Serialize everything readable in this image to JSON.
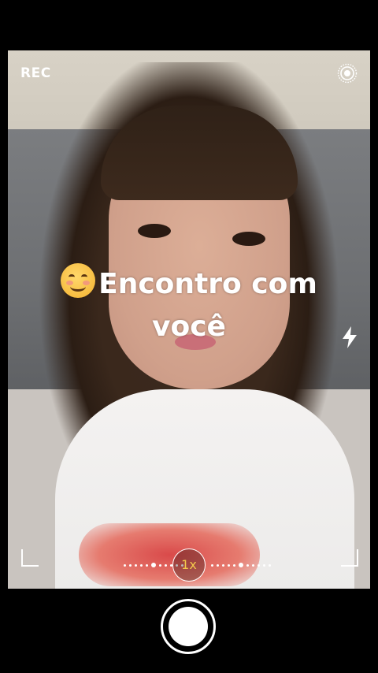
{
  "camera": {
    "mode_label": "REC",
    "caption_text": "Encontro com você",
    "zoom_label": "1x",
    "icons": {
      "top_right": "live-photo-icon",
      "flash": "flash-icon",
      "shutter": "shutter-button"
    }
  },
  "colors": {
    "accent_zoom": "#f2c94c",
    "background": "#000000"
  }
}
